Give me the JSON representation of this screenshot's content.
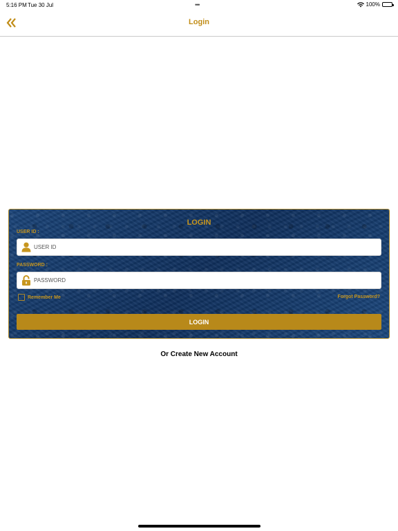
{
  "status_bar": {
    "time": "5:16 PM",
    "date": "Tue 30 Jul",
    "battery": "100%"
  },
  "nav": {
    "title": "Login",
    "back_icon": "double-chevron-left-icon"
  },
  "login_card": {
    "title": "LOGIN",
    "user_id_label": "USER ID :",
    "user_id_placeholder": "USER ID",
    "password_label": "PASSWORD :",
    "password_placeholder": "PASSWORD",
    "remember_label": "Remember Me",
    "forgot_label": "Forgot Password?",
    "login_button": "LOGIN"
  },
  "create_account": "Or Create New Account",
  "colors": {
    "accent": "#c7961f",
    "card_bg": "#143b6e",
    "button_bg": "#b8891a"
  }
}
